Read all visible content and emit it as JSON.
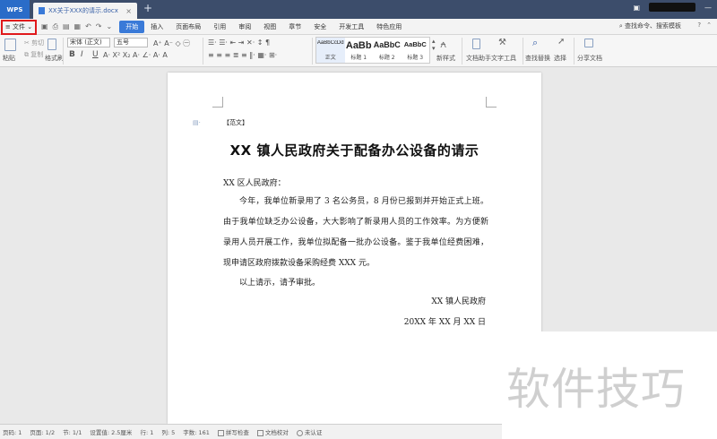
{
  "titlebar": {
    "app_label": "WPS",
    "tab_title": "XX关于XXX的请示.docx",
    "tab_close": "×",
    "tab_add": "+",
    "window_glyph": "▣",
    "minimize": "—"
  },
  "menubar": {
    "file_label": "≡ 文件 ⌄",
    "items": [
      "开始",
      "插入",
      "页面布局",
      "引用",
      "审阅",
      "视图",
      "章节",
      "安全",
      "开发工具",
      "特色应用"
    ],
    "search_label": "查找命令、搜索模板",
    "help": "?"
  },
  "ribbon": {
    "paste": "粘贴",
    "cut": "剪切",
    "copy": "复制",
    "format_painter": "格式刷",
    "font": "宋体 (正文)",
    "size": "五号",
    "bold": "B",
    "italic": "I",
    "underline": "U",
    "styles": [
      {
        "sample": "AaBbCcDd",
        "name": "正文"
      },
      {
        "sample": "AaBb",
        "name": "标题 1"
      },
      {
        "sample": "AaBbC",
        "name": "标题 2"
      },
      {
        "sample": "AaBbC",
        "name": "标题 3"
      }
    ],
    "new_style": "新样式",
    "doc_helper": "文档助手",
    "text_tools": "文字工具",
    "find_replace": "查找替换",
    "select": "选择",
    "share_doc": "分享文档"
  },
  "document": {
    "bracket_title": "【范文】",
    "title": "XX 镇人民政府关于配备办公设备的请示",
    "addressee": "XX 区人民政府：",
    "paragraph1": "今年，我单位新录用了 3 名公务员，8 月份已报到并开始正式上班。由于我单位缺乏办公设备，大大影响了新录用人员的工作效率。为方便新录用人员开展工作，我单位拟配备一批办公设备。鉴于我单位经费困难，现申请区政府拨款设备采购经费 XXX 元。",
    "paragraph2": "以上请示，请予审批。",
    "signature": "XX 镇人民政府",
    "date": "20XX 年 XX 月 XX 日"
  },
  "statusbar": {
    "page_no": "页码: 1",
    "pages": "页面: 1/2",
    "section": "节: 1/1",
    "setting": "设置值: 2.5厘米",
    "row": "行: 1",
    "col": "列: 5",
    "words": "字数: 161",
    "spell_check": "拼写检查",
    "doc_check": "文档校对",
    "uncertified": "未认证"
  },
  "watermark": "软件技巧"
}
